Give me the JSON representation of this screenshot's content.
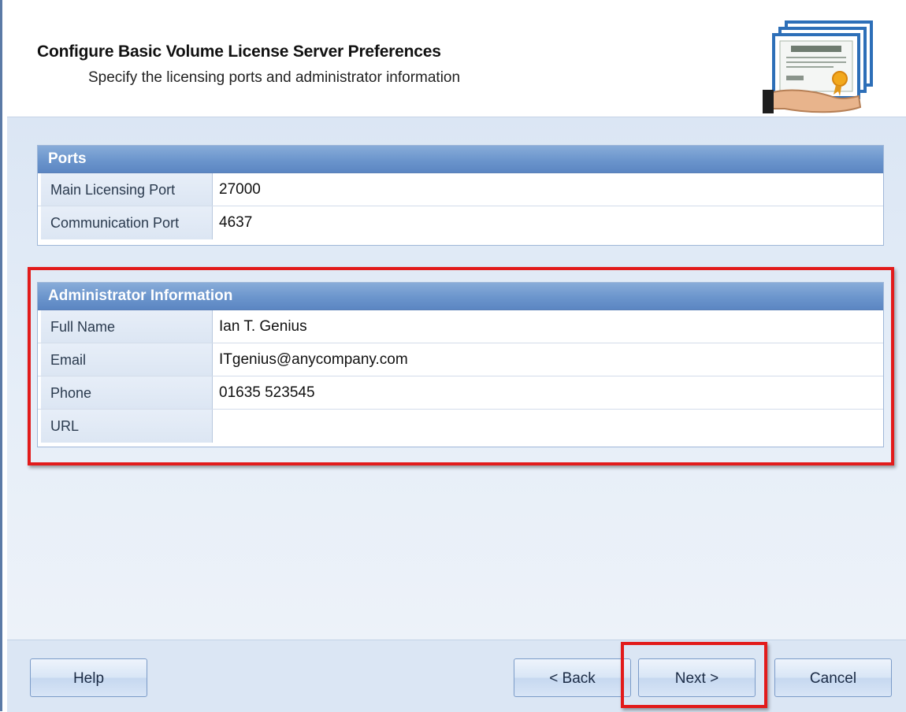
{
  "header": {
    "title": "Configure Basic Volume License Server Preferences",
    "subtitle": "Specify the licensing ports and administrator information",
    "icon": "certificate-documents-icon"
  },
  "ports": {
    "title": "Ports",
    "rows": [
      {
        "label": "Main Licensing Port",
        "value": "27000"
      },
      {
        "label": "Communication Port",
        "value": "4637"
      }
    ]
  },
  "admin": {
    "title": "Administrator Information",
    "rows": [
      {
        "label": "Full Name",
        "value": "Ian T. Genius"
      },
      {
        "label": "Email",
        "value": "ITgenius@anycompany.com"
      },
      {
        "label": "Phone",
        "value": "01635 523545"
      },
      {
        "label": "URL",
        "value": ""
      }
    ]
  },
  "footer": {
    "help_label": "Help",
    "back_label": "< Back",
    "next_label": "Next >",
    "cancel_label": "Cancel"
  },
  "colors": {
    "accent": "#6b95cc",
    "highlight": "#e21b1b",
    "body_bg": "#dbe6f4"
  }
}
